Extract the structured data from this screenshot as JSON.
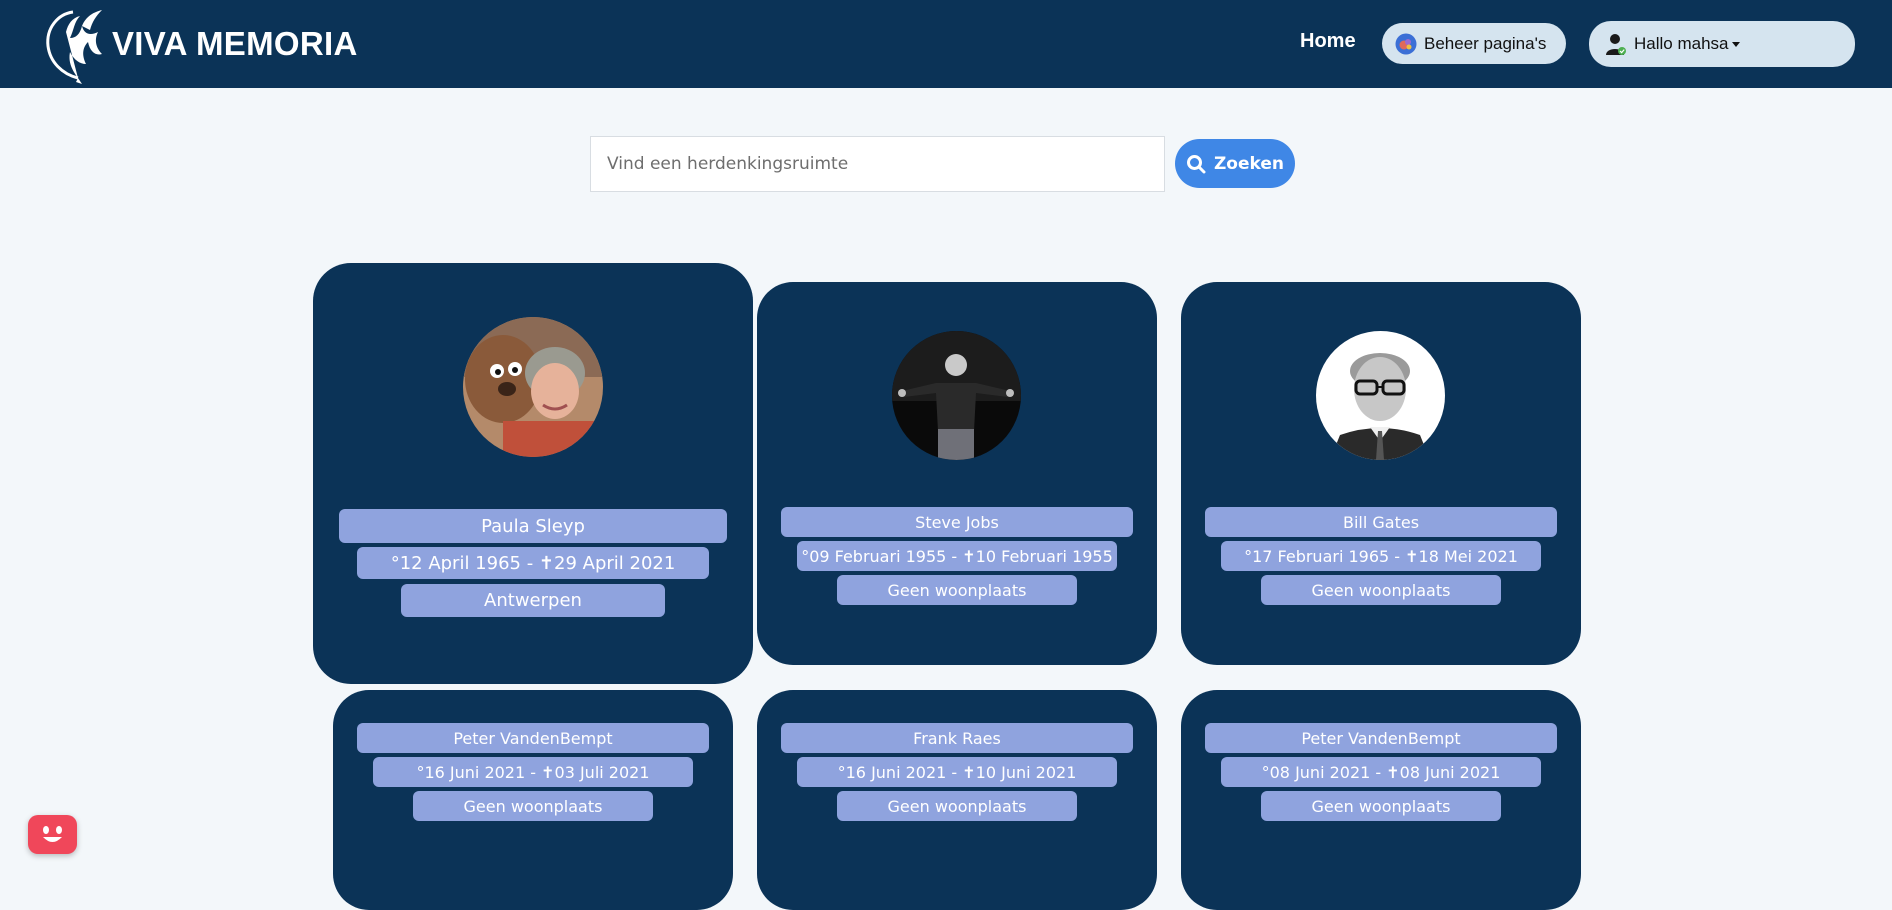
{
  "header": {
    "brand": "VIVA MEMORIA",
    "home_label": "Home",
    "manage_label": "Beheer pagina's",
    "user_greeting": "Hallo mahsa",
    "background_color": "#0b3357"
  },
  "search": {
    "placeholder": "Vind een herdenkingsruimte",
    "value": "",
    "button_label": "Zoeken",
    "button_color": "#3f87e6"
  },
  "cards": [
    {
      "name": "Paula Sleyp",
      "dates": "°12 April 1965 - ✝29 April 2021",
      "place": "Antwerpen",
      "photo": "paula-sleyp-photo"
    },
    {
      "name": "Steve Jobs",
      "dates": "°09 Februari 1955 - ✝10 Februari 1955",
      "place": "Geen woonplaats",
      "photo": "steve-jobs-photo"
    },
    {
      "name": "Bill Gates",
      "dates": "°17 Februari 1965 - ✝18 Mei 2021",
      "place": "Geen woonplaats",
      "photo": "bill-gates-photo"
    },
    {
      "name": "Peter VandenBempt",
      "dates": "°16 Juni 2021 - ✝03 Juli 2021",
      "place": "Geen woonplaats"
    },
    {
      "name": "Frank Raes",
      "dates": "°16 Juni 2021 - ✝10 Juni 2021",
      "place": "Geen woonplaats"
    },
    {
      "name": "Peter VandenBempt",
      "dates": "°08 Juni 2021 - ✝08 Juni 2021",
      "place": "Geen woonplaats"
    }
  ],
  "colors": {
    "card_background": "#0b3357",
    "tag_background": "#8fa3de",
    "page_background": "#f3f7fa",
    "chat_widget": "#f0475a"
  },
  "icons": [
    "phoenix-logo-icon",
    "manage-pages-icon",
    "user-icon",
    "search-icon",
    "chat-bot-icon"
  ]
}
